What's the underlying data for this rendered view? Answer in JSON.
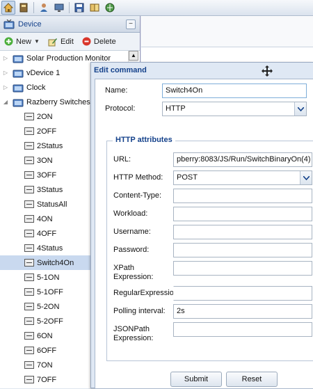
{
  "toolbar": {
    "icons": [
      "home-icon",
      "bookmark-icon",
      "user-icon",
      "display-icon",
      "save-icon",
      "book-icon",
      "globe-icon"
    ]
  },
  "sidebar": {
    "title": "Device",
    "actions": {
      "new_label": "New",
      "edit_label": "Edit",
      "delete_label": "Delete"
    },
    "devices": [
      {
        "label": "Solar Production Monitor"
      },
      {
        "label": "vDevice 1"
      },
      {
        "label": "Clock"
      },
      {
        "label": "Razberry Switches"
      }
    ],
    "commands": [
      "2ON",
      "2OFF",
      "2Status",
      "3ON",
      "3OFF",
      "3Status",
      "StatusAll",
      "4ON",
      "4OFF",
      "4Status",
      "Switch4On",
      "5-1ON",
      "5-1OFF",
      "5-2ON",
      "5-2OFF",
      "6ON",
      "6OFF",
      "7ON",
      "7OFF"
    ],
    "selected": "Switch4On"
  },
  "dialog": {
    "title": "Edit command",
    "name_label": "Name:",
    "name_value": "Switch4On",
    "protocol_label": "Protocol:",
    "protocol_value": "HTTP",
    "http_legend": "HTTP attributes",
    "url_label": "URL:",
    "url_value": "pberry:8083/JS/Run/SwitchBinaryOn(4)",
    "method_label": "HTTP Method:",
    "method_value": "POST",
    "content_type_label": "Content-Type:",
    "workload_label": "Workload:",
    "username_label": "Username:",
    "password_label": "Password:",
    "xpath_label_1": "XPath",
    "xpath_label_2": "Expression:",
    "regex_label": "RegularExpression:",
    "polling_label": "Polling interval:",
    "polling_value": "2s",
    "jsonpath_label_1": "JSONPath",
    "jsonpath_label_2": "Expression:",
    "submit_label": "Submit",
    "reset_label": "Reset"
  }
}
